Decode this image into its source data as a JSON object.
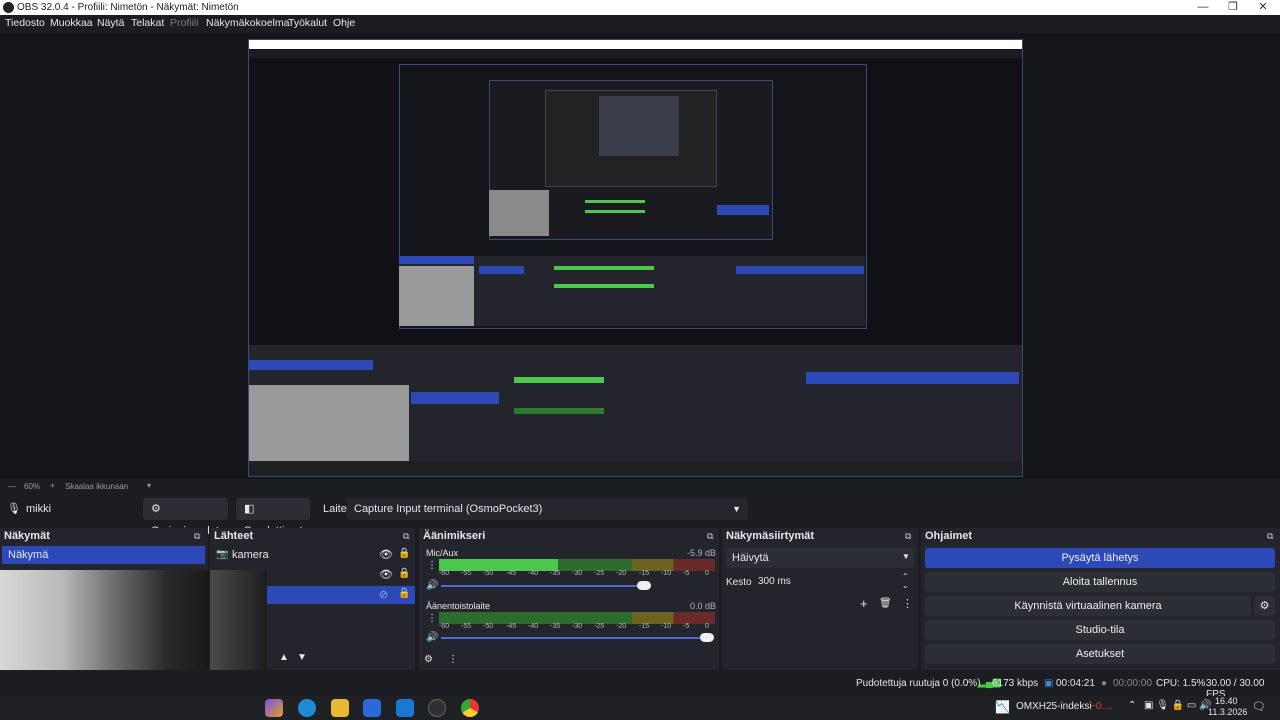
{
  "window": {
    "title": "OBS 32.0.4 - Profiili: Nimetön - Näkymät: Nimetön",
    "minimize": "—",
    "maximize": "❐",
    "close": "✕"
  },
  "menu": [
    "Tiedosto",
    "Muokkaa",
    "Näytä",
    "Telakat",
    "Profiili",
    "Näkymäkokoelma",
    "Työkalut",
    "Ohje"
  ],
  "zoom": {
    "percent": "60%",
    "mode": "Skaalaa ikkunaan"
  },
  "source_toolbar": {
    "source_name": "mikki",
    "properties": "Ominaisuudet",
    "filters": "Suodattimet",
    "device_label": "Laite",
    "device_value": "Capture Input terminal (OsmoPocket3)"
  },
  "scenes": {
    "title": "Näkymät",
    "items": [
      "Näkymä"
    ]
  },
  "sources": {
    "title": "Lähteet",
    "items": [
      "kamera",
      "",
      ""
    ]
  },
  "mixer": {
    "title": "Äänimikseri",
    "channels": [
      {
        "name": "Mic/Aux",
        "db": "-5.9 dB",
        "level": 0.6
      },
      {
        "name": "Äänentoistolaite",
        "db": "0.0 dB",
        "level": 1.0
      }
    ],
    "ticks": [
      "-60",
      "-55",
      "-50",
      "-45",
      "-40",
      "-35",
      "-30",
      "-25",
      "-20",
      "-15",
      "-10",
      "-5",
      "0"
    ]
  },
  "transitions": {
    "title": "Näkymäsiirtymät",
    "type": "Häivytä",
    "duration_label": "Kesto",
    "duration": "300 ms"
  },
  "controls": {
    "title": "Ohjaimet",
    "buttons": [
      "Pysäytä lähetys",
      "Aloita tallennus",
      "Käynnistä virtuaalinen kamera",
      "Studio-tila",
      "Asetukset"
    ]
  },
  "status": {
    "dropped": "Pudotettuja ruutuja 0 (0.0%)",
    "bitrate": "6173 kbps",
    "stream_time": "00:04:21",
    "rec_time": "00:00:00",
    "cpu": "CPU: 1.5%",
    "fps": "30.00 / 30.00 FPS"
  },
  "taskbar": {
    "notification": "OMXH25-indeksi",
    "change": "−0....",
    "time": "16.40",
    "date": "11.3.2026"
  },
  "colors": {
    "accent": "#2d49b8",
    "meter_green": "#4cc94c",
    "meter_yellow": "#c9b23a",
    "meter_red": "#b83a3a"
  }
}
